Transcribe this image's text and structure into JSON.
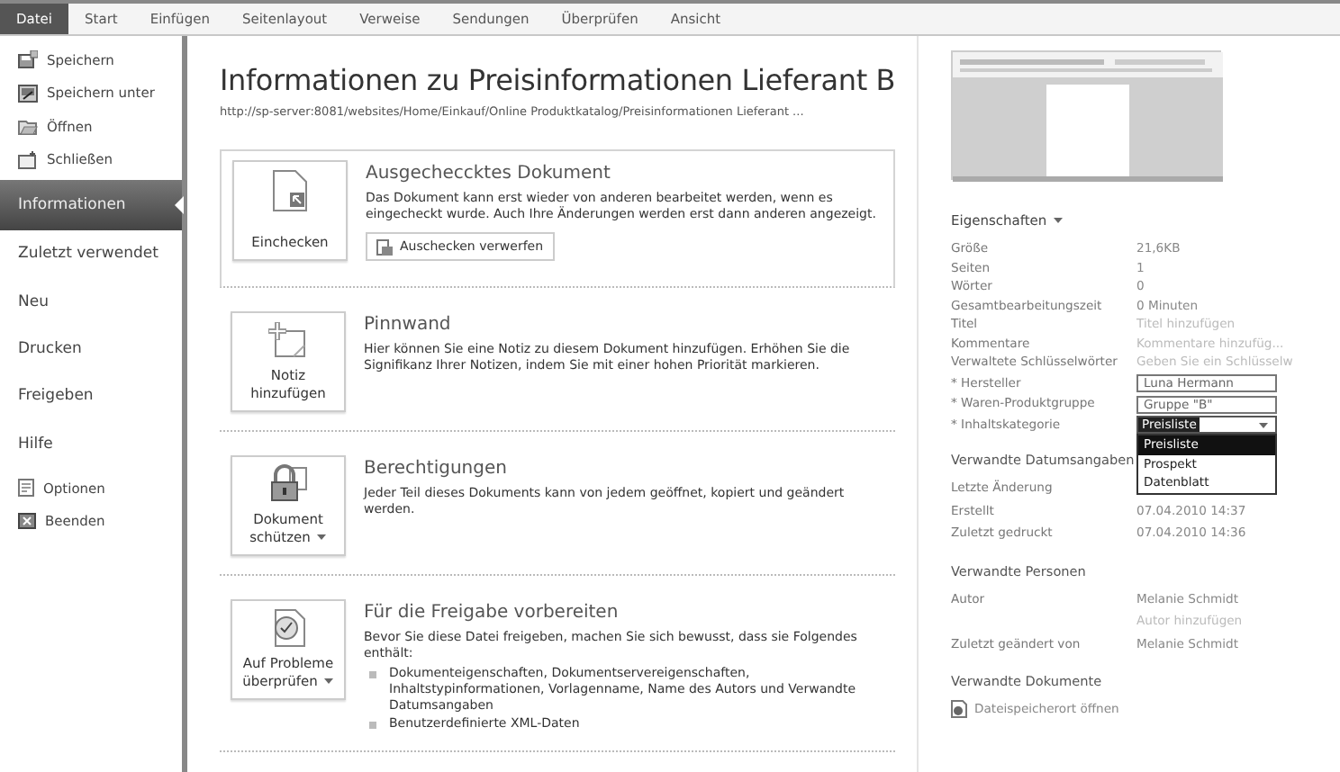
{
  "tabs": [
    {
      "label": "Datei",
      "selected": true
    },
    {
      "label": "Start",
      "selected": false
    },
    {
      "label": "Einfügen",
      "selected": false
    },
    {
      "label": "Seitenlayout",
      "selected": false
    },
    {
      "label": "Verweise",
      "selected": false
    },
    {
      "label": "Sendungen",
      "selected": false
    },
    {
      "label": "Überprüfen",
      "selected": false
    },
    {
      "label": "Ansicht",
      "selected": false
    }
  ],
  "sidebar": {
    "items": [
      {
        "label": "Speichern",
        "kind": "command",
        "selected": false
      },
      {
        "label": "Speichern unter",
        "kind": "command",
        "selected": false
      },
      {
        "label": "Öffnen",
        "kind": "command",
        "selected": false
      },
      {
        "label": "Schließen",
        "kind": "command",
        "selected": false
      },
      {
        "label": "Informationen",
        "kind": "page",
        "selected": true
      },
      {
        "label": "Zuletzt verwendet",
        "kind": "page",
        "selected": false
      },
      {
        "label": "Neu",
        "kind": "page",
        "selected": false
      },
      {
        "label": "Drucken",
        "kind": "page",
        "selected": false
      },
      {
        "label": "Freigeben",
        "kind": "page",
        "selected": false
      },
      {
        "label": "Hilfe",
        "kind": "page",
        "selected": false
      },
      {
        "label": "Optionen",
        "kind": "command",
        "selected": false
      },
      {
        "label": "Beenden",
        "kind": "command",
        "selected": false
      }
    ]
  },
  "title": "Informationen zu Preisinformationen Lieferant B",
  "path": "http://sp-server:8081/websites/Home/Einkauf/Online Produktkatalog/Preisinformationen Lieferant ...",
  "sections": [
    {
      "button": "Einchecken",
      "dropdown": false,
      "bordered": true,
      "heading": "Ausgecheccktes Dokument",
      "text": "Das Dokument kann erst wieder von anderen bearbeitet werden, wenn es eingecheckt wurde. Auch Ihre Änderungen werden erst dann anderen angezeigt.",
      "action": "Auschecken verwerfen"
    },
    {
      "button": "Notiz hinzufügen",
      "dropdown": false,
      "bordered": false,
      "heading": "Pinnwand",
      "text": "Hier können Sie eine Notiz zu diesem Dokument hinzufügen. Erhöhen Sie die Signifikanz Ihrer Notizen, indem Sie mit einer hohen Priorität markieren."
    },
    {
      "button": "Dokument schützen",
      "dropdown": true,
      "bordered": false,
      "heading": "Berechtigungen",
      "text": "Jeder Teil dieses Dokuments kann von jedem geöffnet, kopiert und geändert werden."
    },
    {
      "button": "Auf Probleme überprüfen",
      "dropdown": true,
      "bordered": false,
      "heading": "Für die Freigabe vorbereiten",
      "text": "Bevor Sie diese Datei freigeben, machen Sie sich bewusst, dass sie Folgendes enthält:",
      "bullets": [
        "Dokumenteigenschaften, Dokumentservereigenschaften, Inhaltstypinformationen, Vorlagenname, Name des Autors und Verwandte Datumsangaben",
        "Benutzerdefinierte XML-Daten"
      ]
    }
  ],
  "properties": {
    "heading": "Eigenschaften",
    "rows": [
      {
        "kind": "text",
        "label": "Größe",
        "value": "21,6KB"
      },
      {
        "kind": "text",
        "label": "Seiten",
        "value": "1"
      },
      {
        "kind": "text",
        "label": "Wörter",
        "value": "0"
      },
      {
        "kind": "text",
        "label": "Gesamtbearbeitungszeit",
        "value": "0 Minuten"
      },
      {
        "kind": "hint",
        "label": "Titel",
        "placeholder": "Titel hinzufügen"
      },
      {
        "kind": "hint",
        "label": "Kommentare",
        "placeholder": "Kommentare hinzufüg..."
      },
      {
        "kind": "hint",
        "label": "Verwaltete Schlüsselwörter",
        "placeholder": "Geben Sie ein Schlüsselw"
      },
      {
        "kind": "input",
        "label": "* Hersteller",
        "value": "Luna Hermann"
      },
      {
        "kind": "input",
        "label": "* Waren-Produktgruppe",
        "value": "Gruppe \"B\""
      },
      {
        "kind": "select",
        "label": "* Inhaltskategorie",
        "value": "Preisliste",
        "expanded": true,
        "options": [
          {
            "label": "Preisliste",
            "selected": true
          },
          {
            "label": "Prospekt",
            "selected": false
          },
          {
            "label": "Datenblatt",
            "selected": false
          }
        ]
      }
    ]
  },
  "groups": [
    {
      "heading": "Verwandte Datumsangaben",
      "rows": [
        {
          "label": "Letzte Änderung"
        },
        {
          "label": "Erstellt",
          "value": "07.04.2010 14:37"
        },
        {
          "label": "Zuletzt gedruckt",
          "value": "07.04.2010 14:36"
        }
      ]
    },
    {
      "heading": "Verwandte Personen",
      "rows": [
        {
          "label": "Autor",
          "value": "Melanie Schmidt"
        },
        {
          "label": "",
          "link": "Autor hinzufügen"
        },
        {
          "label": "Zuletzt geändert von",
          "value": "Melanie Schmidt"
        }
      ]
    },
    {
      "heading": "Verwandte Dokumente",
      "links": [
        "Dateispeicherort öffnen"
      ]
    }
  ]
}
